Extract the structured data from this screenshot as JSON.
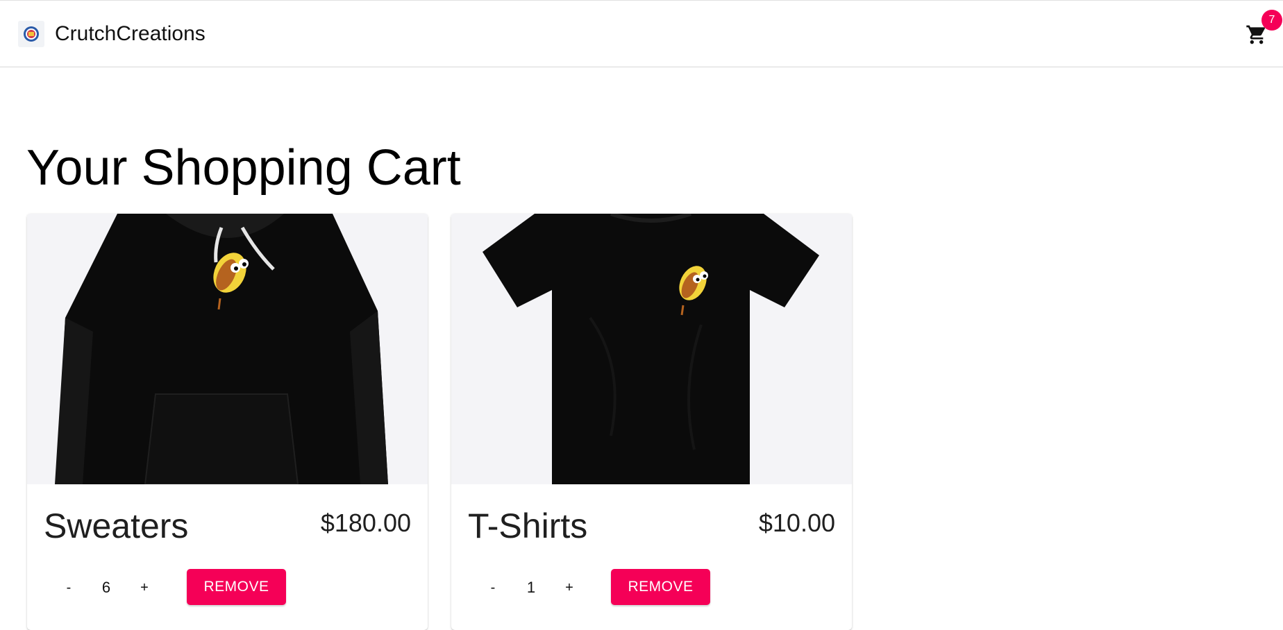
{
  "header": {
    "brand": "CrutchCreations",
    "cart_count": "7",
    "colors": {
      "badge": "#f50057",
      "accent": "#f50057"
    }
  },
  "main": {
    "title": "Your Shopping Cart",
    "items": [
      {
        "name": "Sweaters",
        "price": "$180.00",
        "quantity": "6",
        "minus_label": "-",
        "plus_label": "+",
        "remove_label": "REMOVE",
        "image": "black-hoodie-with-taco-graphic"
      },
      {
        "name": "T-Shirts",
        "price": "$10.00",
        "quantity": "1",
        "minus_label": "-",
        "plus_label": "+",
        "remove_label": "REMOVE",
        "image": "black-tshirt-with-taco-graphic"
      }
    ]
  },
  "icons": {
    "cart": "shopping-cart-icon",
    "logo": "brand-logo-icon"
  }
}
